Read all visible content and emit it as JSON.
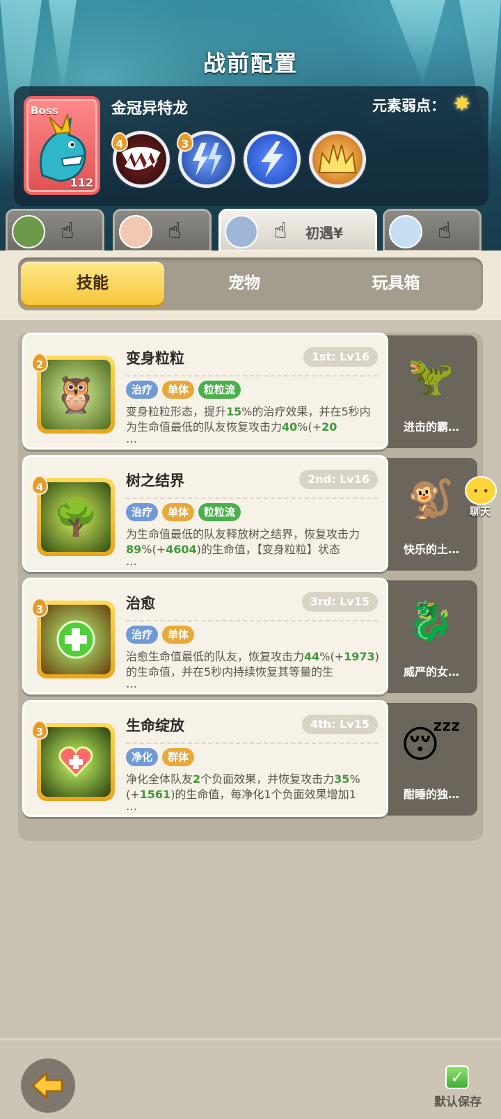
{
  "header": {
    "title": "战前配置"
  },
  "boss": {
    "tag": "Boss",
    "level": "112",
    "name": "金冠异特龙",
    "weakness_label": "元素弱点：",
    "weakness_icon": "light-star-icon",
    "skills": [
      {
        "icon": "fang-bite-icon",
        "badge": "4",
        "color": "#5a1d1d"
      },
      {
        "icon": "lightning-bolts-icon",
        "badge": "3",
        "color": "#2a4fa8"
      },
      {
        "icon": "lightning-icon",
        "badge": "",
        "color": "#2f63d0"
      },
      {
        "icon": "golden-crown-spikes-icon",
        "badge": "",
        "color": "#d98a1e"
      }
    ]
  },
  "heroes": [
    {
      "avatar": "hero-warrior-avatar",
      "text": ""
    },
    {
      "avatar": "hero-redhair-avatar",
      "text": ""
    },
    {
      "avatar": "hero-goggles-avatar",
      "text": "初遇¥"
    },
    {
      "avatar": "hero-bluehair-avatar",
      "text": ""
    }
  ],
  "tabs": {
    "skills": "技能",
    "pets": "宠物",
    "toybox": "玩具箱"
  },
  "skills": [
    {
      "badge": "2",
      "icon": "owl-transform-icon",
      "name": "变身粒粒",
      "rank": "1st: Lv16",
      "tags": [
        "治疗",
        "单体",
        "粒粒流"
      ],
      "desc_a": "变身粒粒形态，提升",
      "num_a": "15",
      "desc_b": "%的治疗效果，并在5秒内为生命值最低的队友恢复攻击力",
      "num_b": "40",
      "desc_c": "%(+",
      "num_c": "20",
      "desc_d": "",
      "pet_name": "进击的霸…",
      "pet_icon": "red-dino-pet"
    },
    {
      "badge": "4",
      "icon": "tree-barrier-icon",
      "name": "树之结界",
      "rank": "2nd: Lv16",
      "tags": [
        "治疗",
        "单体",
        "粒粒流"
      ],
      "desc_a": "为生命值最低的队友释放树之结界，恢复攻击力",
      "num_a": "89",
      "desc_b": "%(+",
      "num_b": "4604",
      "desc_c": ")的生命值，【变身粒粒】状态",
      "num_c": "",
      "desc_d": "",
      "pet_name": "快乐的土…",
      "pet_icon": "monkey-pet"
    },
    {
      "badge": "3",
      "icon": "heal-cross-icon",
      "name": "治愈",
      "rank": "3rd: Lv15",
      "tags": [
        "治疗",
        "单体"
      ],
      "desc_a": "治愈生命值最低的队友，恢复攻击力",
      "num_a": "44",
      "desc_b": "%(+",
      "num_b": "1973",
      "desc_c": ")的生命值，并在5秒内持续恢复其等量的生",
      "num_c": "",
      "desc_d": "",
      "pet_name": "威严的女…",
      "pet_icon": "dragon-queen-pet"
    },
    {
      "badge": "3",
      "icon": "heart-bloom-icon",
      "name": "生命绽放",
      "rank": "4th: Lv15",
      "tags": [
        "净化",
        "群体"
      ],
      "desc_a": "净化全体队友",
      "num_a": "2",
      "desc_b": "个负面效果，并恢复攻击力",
      "num_b": "35",
      "desc_c": "%(+",
      "num_c": "1561",
      "desc_d": ")的生命值，每净化1个负面效果增加1",
      "pet_name": "酣睡的独…",
      "pet_icon": "sleepy-caveman-pet"
    }
  ],
  "ellipsis": "…",
  "chat": {
    "label": "聊天"
  },
  "footer": {
    "save_label": "默认保存"
  }
}
